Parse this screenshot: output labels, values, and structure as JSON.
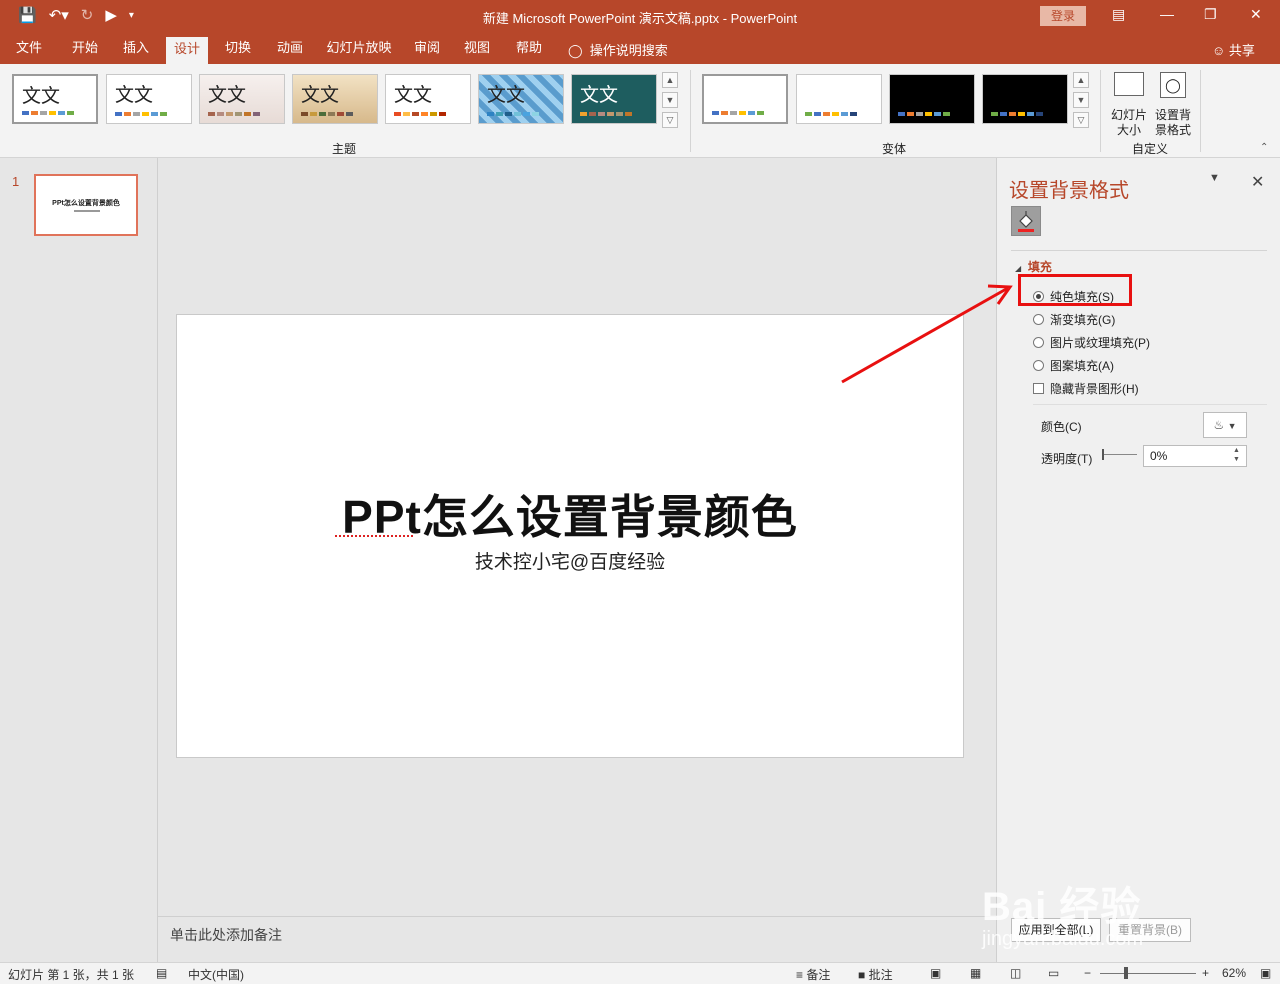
{
  "window": {
    "title": "新建 Microsoft PowerPoint 演示文稿.pptx  -  PowerPoint",
    "login_label": "登录"
  },
  "tabs": [
    "文件",
    "开始",
    "插入",
    "设计",
    "切换",
    "动画",
    "幻灯片放映",
    "审阅",
    "视图",
    "帮助"
  ],
  "active_tab": "设计",
  "tellme": "操作说明搜索",
  "share": "共享",
  "ribbon": {
    "themes_group": "主题",
    "variants_group": "变体",
    "customize_group": "自定义",
    "theme_sample_text": "文文",
    "slide_size_label": "幻灯片大小",
    "format_bg_label": "设置背景格式"
  },
  "thumbnails": {
    "slide_number": "1",
    "thumb_title": "PPt怎么设置背景颜色"
  },
  "slide": {
    "title": "PPt怎么设置背景颜色",
    "subtitle": "技术控小宅@百度经验"
  },
  "notes_placeholder": "单击此处添加备注",
  "pane": {
    "title": "设置背景格式",
    "section": "填充",
    "options": {
      "solid": "纯色填充(S)",
      "gradient": "渐变填充(G)",
      "picture": "图片或纹理填充(P)",
      "pattern": "图案填充(A)",
      "hide": "隐藏背景图形(H)"
    },
    "color_label": "颜色(C)",
    "transparency_label": "透明度(T)",
    "transparency_value": "0%",
    "apply_all": "应用到全部(L)",
    "reset_bg": "重置背景(B)"
  },
  "statusbar": {
    "slide_info": "幻灯片 第 1 张，共 1 张",
    "language": "中文(中国)",
    "notes": "备注",
    "comments": "批注",
    "zoom": "62%"
  },
  "watermark": {
    "brand": "Bai 经验",
    "url": "jingyan.baidu.com"
  },
  "colors": {
    "accent": "#b7472a",
    "highlight": "#e81010"
  }
}
